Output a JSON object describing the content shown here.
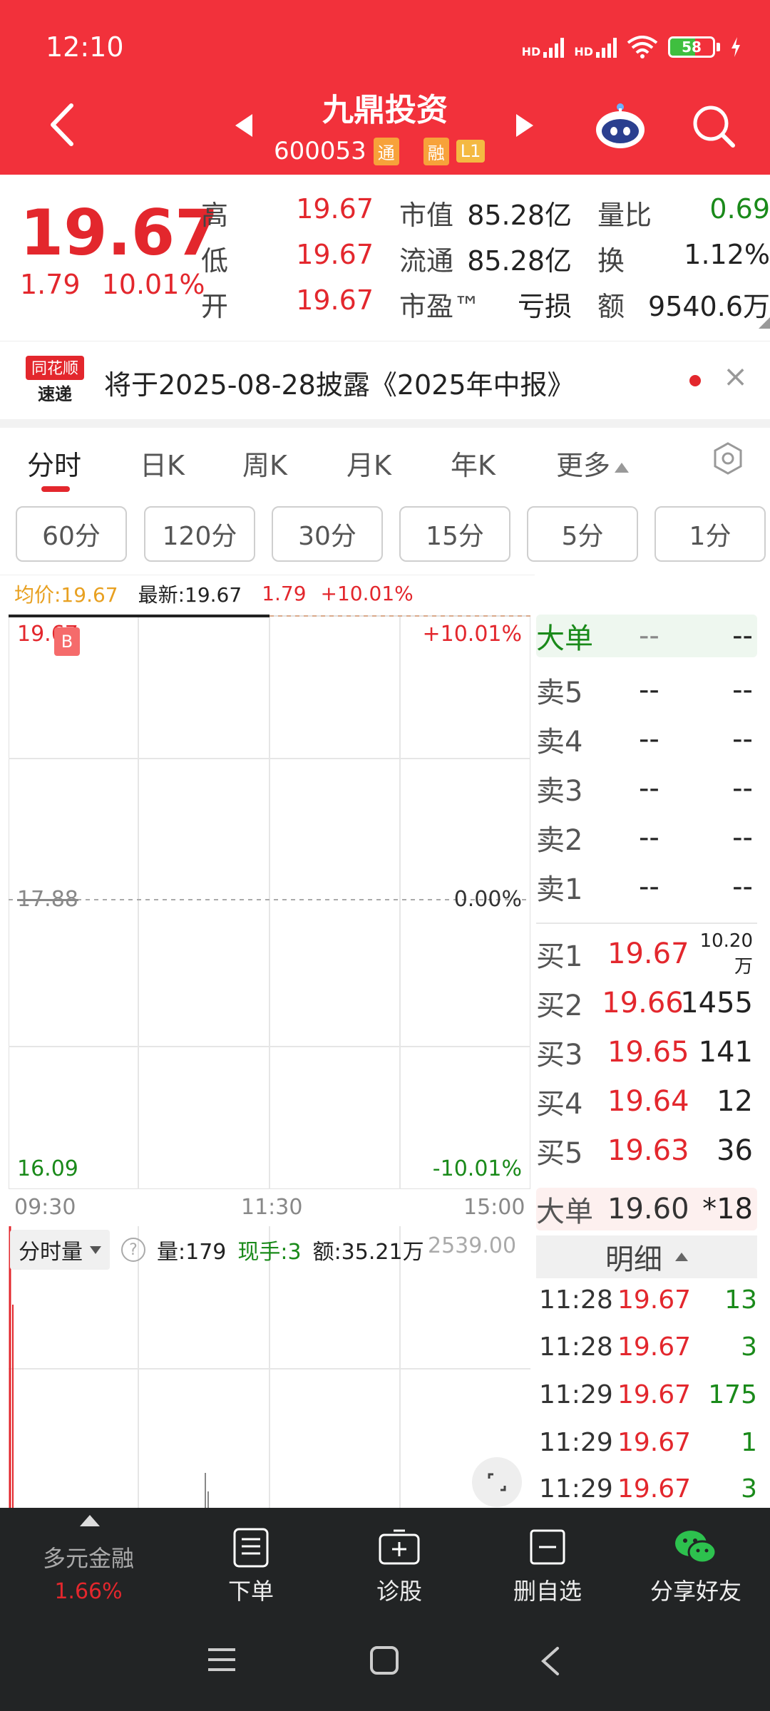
{
  "status": {
    "time": "12:10",
    "battery": "58",
    "hd1": "HD",
    "hd2": "HD"
  },
  "header": {
    "name": "九鼎投资",
    "code": "600053",
    "tags": [
      "通",
      "融",
      "L1"
    ]
  },
  "quote": {
    "price": "19.67",
    "change": "1.79",
    "change_pct": "10.01%",
    "rows": [
      {
        "l1": "高",
        "v1": "19.67",
        "l2": "市值",
        "v2": "85.28亿",
        "l3": "量比",
        "v3": "0.69"
      },
      {
        "l1": "低",
        "v1": "19.67",
        "l2": "流通",
        "v2": "85.28亿",
        "l3": "换",
        "v3": "1.12%"
      },
      {
        "l1": "开",
        "v1": "19.67",
        "l2": "市盈™",
        "v2": "亏损",
        "l3": "额",
        "v3": "9540.6万"
      }
    ]
  },
  "news": {
    "logo_line1": "同花顺",
    "logo_line2": "速递",
    "text": "将于2025-08-28披露《2025年中报》",
    "close": "×"
  },
  "tabs": [
    "分时",
    "日K",
    "周K",
    "月K",
    "年K",
    "更多"
  ],
  "periods": [
    "60分",
    "120分",
    "30分",
    "15分",
    "5分",
    "1分"
  ],
  "info_strip": {
    "avg": "均价:19.67",
    "latest": "最新:19.67",
    "change": "1.79",
    "change_pct": "+10.01%"
  },
  "chart": {
    "top_price": "19.67",
    "mid_price": "17.88",
    "bottom_price": "16.09",
    "top_pct": "+10.01%",
    "mid_pct": "0.00%",
    "bottom_pct": "-10.01%",
    "times": [
      "09:30",
      "11:30",
      "15:00"
    ],
    "b_marker": "B"
  },
  "orderbook": {
    "big_label": "大单",
    "big_a": "--",
    "big_b": "--",
    "sell": [
      {
        "label": "卖5",
        "price": "--",
        "vol": "--"
      },
      {
        "label": "卖4",
        "price": "--",
        "vol": "--"
      },
      {
        "label": "卖3",
        "price": "--",
        "vol": "--"
      },
      {
        "label": "卖2",
        "price": "--",
        "vol": "--"
      },
      {
        "label": "卖1",
        "price": "--",
        "vol": "--"
      }
    ],
    "buy": [
      {
        "label": "买1",
        "price": "19.67",
        "vol": "10.20万"
      },
      {
        "label": "买2",
        "price": "19.66",
        "vol": "1455"
      },
      {
        "label": "买3",
        "price": "19.65",
        "vol": "141"
      },
      {
        "label": "买4",
        "price": "19.64",
        "vol": "12"
      },
      {
        "label": "买5",
        "price": "19.63",
        "vol": "36"
      }
    ],
    "big2_label": "大单",
    "big2_price": "19.60",
    "big2_vol": "*18"
  },
  "detail": {
    "title": "明细",
    "rows": [
      {
        "time": "11:28",
        "price": "19.67",
        "vol": "13"
      },
      {
        "time": "11:28",
        "price": "19.67",
        "vol": "3"
      },
      {
        "time": "11:29",
        "price": "19.67",
        "vol": "175"
      },
      {
        "time": "11:29",
        "price": "19.67",
        "vol": "1"
      },
      {
        "time": "11:29",
        "price": "19.67",
        "vol": "3"
      }
    ]
  },
  "volume": {
    "select": "分时量",
    "help": "?",
    "amount_vol": "量:179",
    "current": "现手:3",
    "amount": "额:35.21万",
    "max": "2539.00"
  },
  "bottom_nav": {
    "sector": "多元金融",
    "sector_pct": "1.66%",
    "items": [
      "下单",
      "诊股",
      "删自选",
      "分享好友"
    ]
  }
}
